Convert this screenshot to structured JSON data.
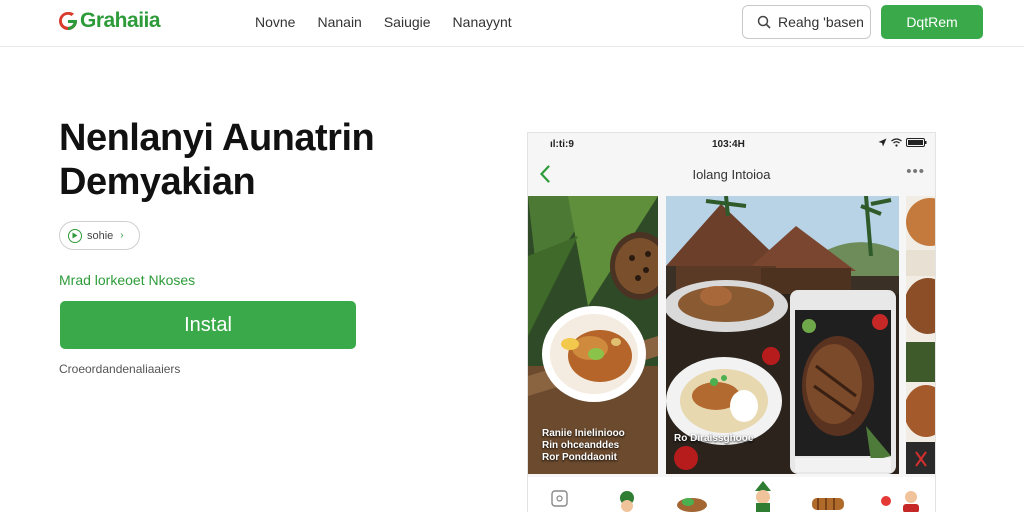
{
  "brand": {
    "name": "Grahaiia"
  },
  "nav": {
    "items": [
      "Novne",
      "Nanain",
      "Saiugie",
      "Nanayynt"
    ]
  },
  "header": {
    "search_label": "Reahg 'basen",
    "primary_label": "DqtRem"
  },
  "hero": {
    "title_line1": "Nenlanyi Aunatrin",
    "title_line2": "Demyakian",
    "pill_label": "sohie",
    "link_text": "Mrad lorkeoet Nkoses",
    "install_label": "Instal",
    "note": "Croeordandenaliaaiers"
  },
  "phone": {
    "time_left": "ıl:ti:9",
    "time_center": "103:4H",
    "screen_title": "Iolang Intoioa",
    "card1_caption": [
      "Raniie Inieliniooo",
      "Rin ohceanddes",
      "Ror Ponddaonit"
    ],
    "card2_caption": "Ro Diraissghooe"
  },
  "colors": {
    "accent": "#3aa94a",
    "brand_green": "#2e9b3a",
    "brand_red": "#d93a2b"
  }
}
